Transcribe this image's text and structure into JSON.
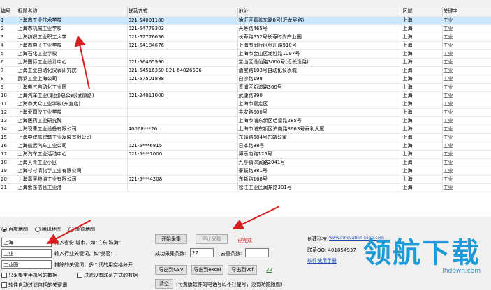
{
  "grid": {
    "columns": [
      "编号",
      "标题名称",
      "联系方式",
      "地址",
      "区域",
      "关键字"
    ],
    "rows": [
      [
        "1",
        "上海市工业技术学校",
        "021-54091100",
        "徐汇区嘉善东路8号(近龙吴路)",
        "上海",
        "工业"
      ],
      [
        "2",
        "上海市机械工业学校",
        "021-64779303",
        "天等路465号",
        "上海",
        "工业"
      ],
      [
        "3",
        "上海纺织工业职工大学",
        "021-62776636",
        "长寿路652号长寿时尚产业园",
        "上海",
        "工业"
      ],
      [
        "4",
        "上海市电子工业学校",
        "021-64184676",
        "上海市闵行区剑川路910号",
        "上海",
        "工业"
      ],
      [
        "5",
        "上海石化工业学校",
        "",
        "上海市金山区龙胜路1097号",
        "上海",
        "工业"
      ],
      [
        "6",
        "上海国际工业设计中心",
        "021-56465990",
        "宝山区逸仙路3000号(近长逸路)",
        "上海",
        "工业"
      ],
      [
        "7",
        "上海工业自动化仪表研究院",
        "021-64516350 021-64826536",
        "漕宝路103号自动化仪表城",
        "上海",
        "工业"
      ],
      [
        "8",
        "武钢工业上海公司",
        "021-57501888",
        "白沙路198",
        "上海",
        "工业"
      ],
      [
        "9",
        "上海电气自动化工业园",
        "",
        "青浦区新谊路360号",
        "上海",
        "工业"
      ],
      [
        "10",
        "上海汽车工业(集团)总公司(武康路)",
        "021-24011000",
        "武康路390",
        "上海",
        "工业"
      ],
      [
        "11",
        "上海市大众工业学校(东宣店)",
        "",
        "上海市嘉定区",
        "上海",
        "工业"
      ],
      [
        "12",
        "上海爱国仪工业学校",
        "",
        "丰安路600号",
        "上海",
        "工业"
      ],
      [
        "13",
        "上海医药工业研究院",
        "",
        "上海市浦东新区哈雷路285号",
        "上海",
        "工业"
      ],
      [
        "14",
        "上海现曹工业设备有限公司",
        "40068***26",
        "上海市浦东新区沪南路3663号泰利大厦",
        "上海",
        "工业"
      ],
      [
        "15",
        "上海中建航建筑工业发展有限公司",
        "",
        "东靖路684号东靖公寓",
        "上海",
        "工业"
      ],
      [
        "16",
        "上海航远汽车工业公司",
        "021-5***6815",
        "日本路38号",
        "上海",
        "工业"
      ],
      [
        "17",
        "上海汽车工业活动中心",
        "021-5***1000",
        "博乐南路125号",
        "上海",
        "工业"
      ],
      [
        "18",
        "上海天青工业小区",
        "",
        "九亭镇涞寅路2041号",
        "上海",
        "工业"
      ],
      [
        "19",
        "上海杉杉清化学工业有限公司",
        "",
        "泰联路881号",
        "上海",
        "工业"
      ],
      [
        "20",
        "上海嘉里粮油工业有限公司",
        "021-5***4208",
        "东新路168号",
        "上海",
        "工业"
      ],
      [
        "21",
        "上海紫东信息工业港",
        "",
        "松江工业区润东路301号",
        "上海",
        "工业"
      ]
    ]
  },
  "panel": {
    "map_options": [
      "百度地图",
      "腾讯地图",
      "高德地图"
    ],
    "selected_map": 0,
    "city_value": "上海",
    "city_hint": "输入省份 城市，如\"广东 珠海\"",
    "industry_value": "工业",
    "industry_hint": "输入行业关键词，如\"美容\"",
    "exclude_value": "工业园",
    "exclude_hint": "排除的关键词，多个词的用空格分开",
    "phone_only_label": "只采集带手机号的数据",
    "no_dup_label": "过滤没有联系方式的数据",
    "keyword_filter_label": "软件自动过滤包括的关键词",
    "start_label": "开始采集",
    "stop_label": "停止采集",
    "status_text": "已完成",
    "success_label": "成功采集条数:",
    "success_value": "27",
    "dup_label": "去重条数:",
    "dup_value": "",
    "export_csv": "导出到CSV",
    "export_excel": "导出到excel",
    "export_vcf": "导出到vcf",
    "export_count": "22",
    "clear_label": "清空",
    "footer_note": "(付费版软件的电话号码不打星号，没有功能限制)",
    "company_name": "创建科技",
    "company_url": "www.innovation-soon.com",
    "contact_label": "联系QQ: 401054937",
    "manual_link": "软件使用手册"
  },
  "watermark": {
    "brand": "领航下载",
    "site": "lhdown.com"
  }
}
